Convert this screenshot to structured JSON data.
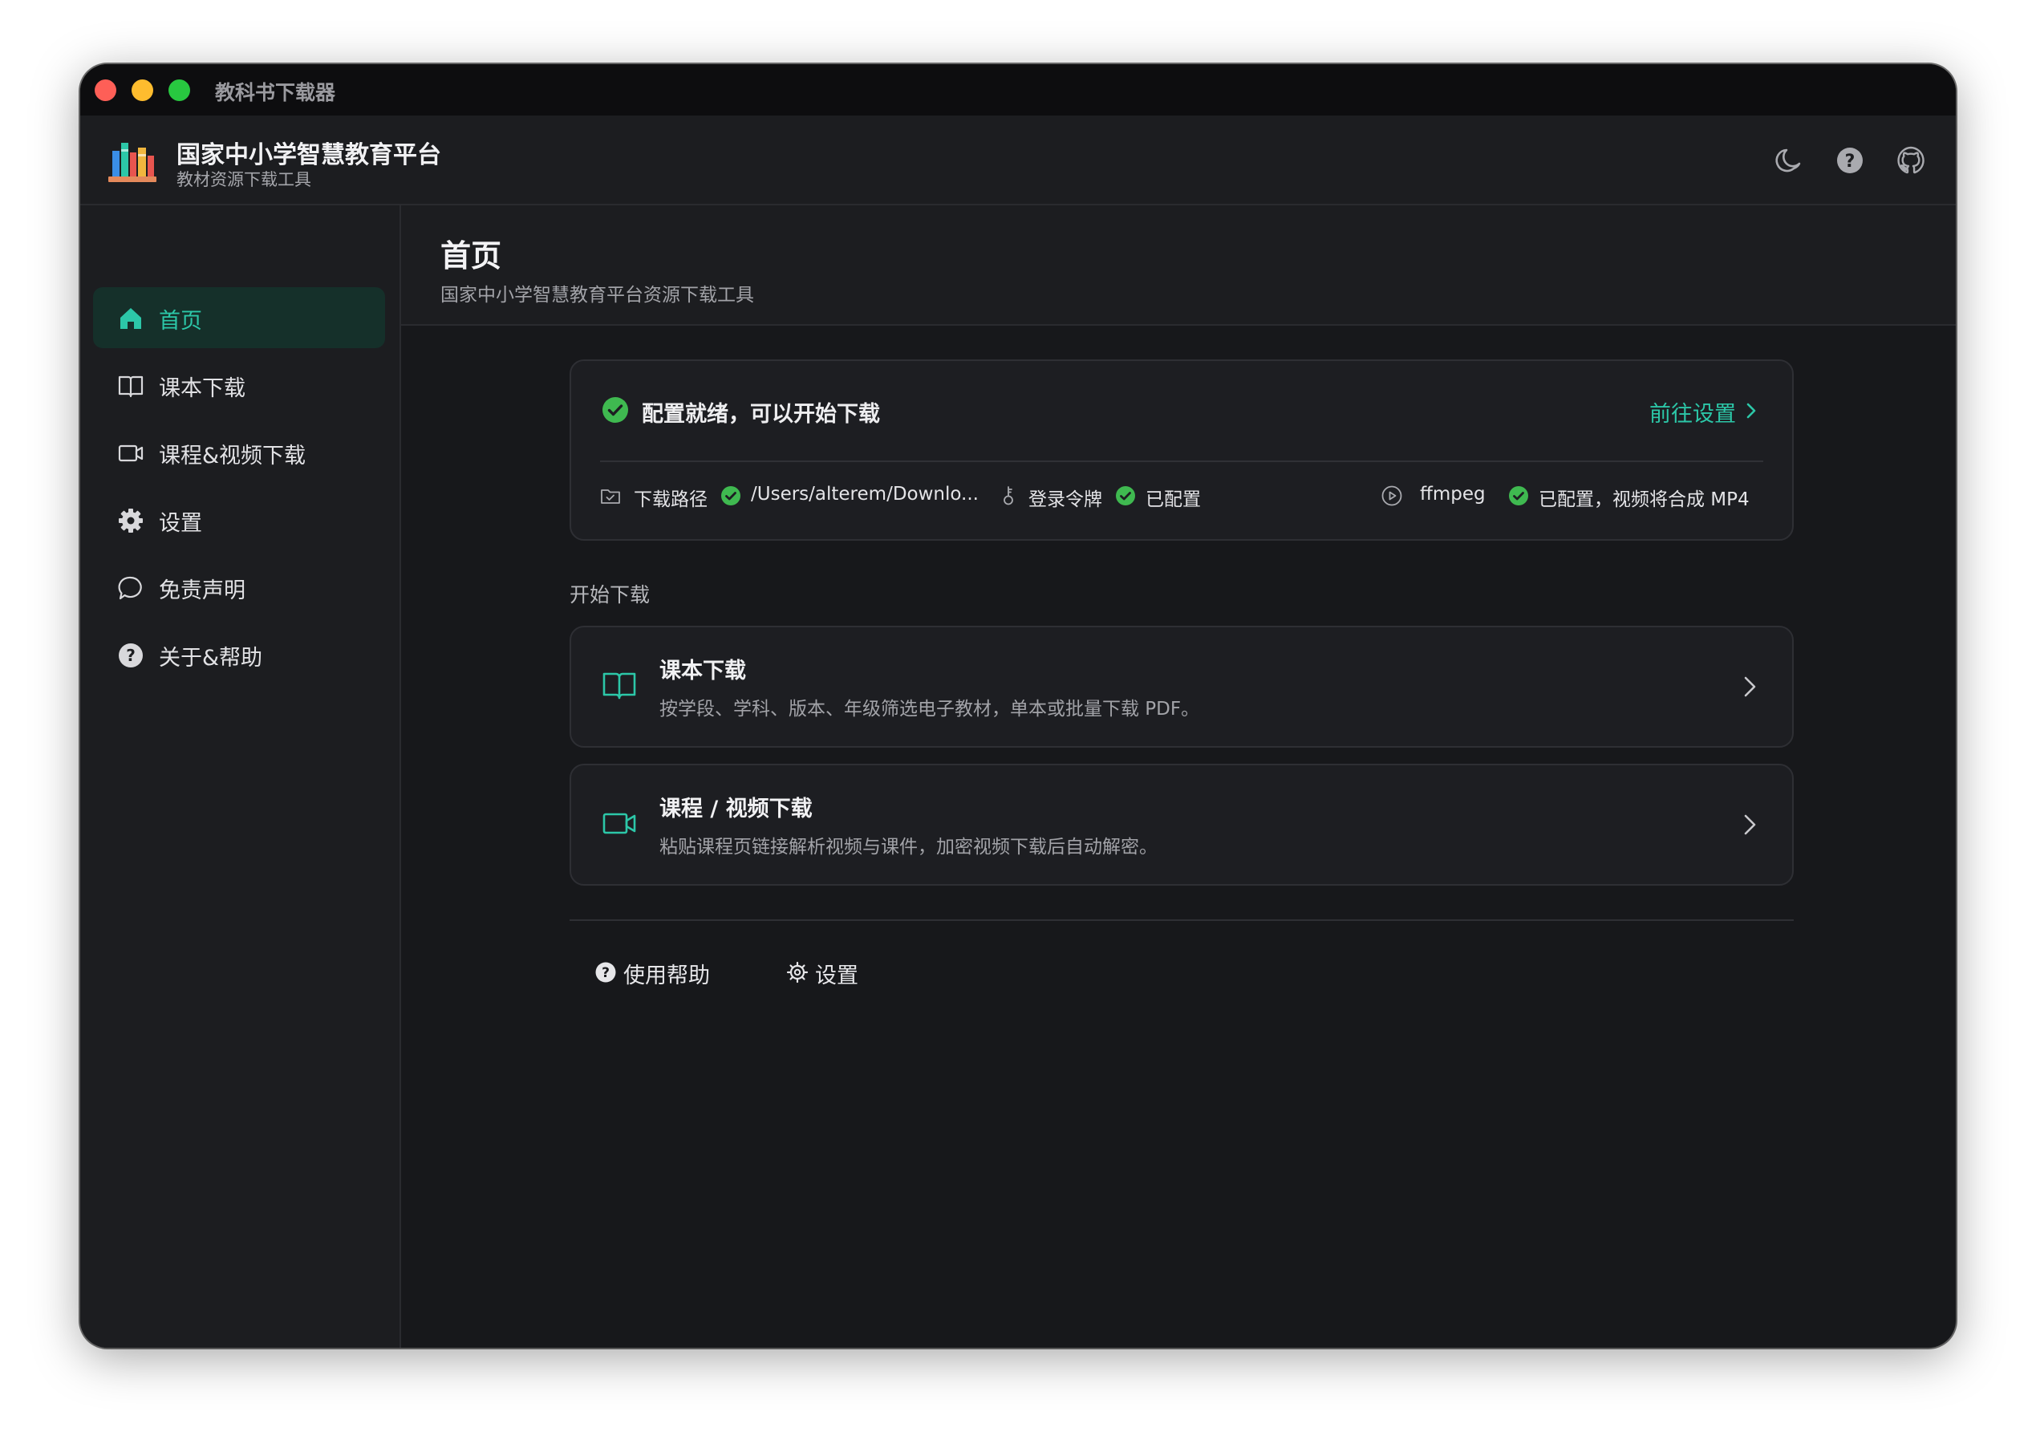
{
  "window": {
    "title": "教科书下载器"
  },
  "header": {
    "app_name": "国家中小学智慧教育平台",
    "app_subtitle": "教材资源下载工具"
  },
  "sidebar": {
    "items": [
      {
        "label": "首页",
        "icon": "home-icon",
        "active": true
      },
      {
        "label": "课本下载",
        "icon": "book-icon"
      },
      {
        "label": "课程&视频下载",
        "icon": "video-icon"
      },
      {
        "label": "设置",
        "icon": "gear-icon"
      },
      {
        "label": "免责声明",
        "icon": "chat-bubble-icon"
      },
      {
        "label": "关于&帮助",
        "icon": "help-circle-icon"
      }
    ]
  },
  "page": {
    "title": "首页",
    "subtitle": "国家中小学智慧教育平台资源下载工具"
  },
  "status": {
    "headline": "配置就绪，可以开始下载",
    "goto_settings": "前往设置",
    "items": {
      "download_path": {
        "label": "下载路径",
        "value": "/Users/alterem/Downlo..."
      },
      "login_token": {
        "label": "登录令牌",
        "value": "已配置"
      },
      "ffmpeg": {
        "label": "ffmpeg",
        "value": "已配置，视频将合成 MP4"
      }
    }
  },
  "start_download": {
    "section_label": "开始下载",
    "actions": [
      {
        "title": "课本下载",
        "desc": "按学段、学科、版本、年级筛选电子教材，单本或批量下载 PDF。"
      },
      {
        "title": "课程 / 视频下载",
        "desc": "粘贴课程页链接解析视频与课件，加密视频下载后自动解密。"
      }
    ]
  },
  "footer_links": {
    "help": "使用帮助",
    "settings": "设置"
  },
  "colors": {
    "accent": "#2cc7a8",
    "ok_green": "#3fb950",
    "window_bg": "#17181b",
    "panel_bg": "#1c1d20"
  }
}
